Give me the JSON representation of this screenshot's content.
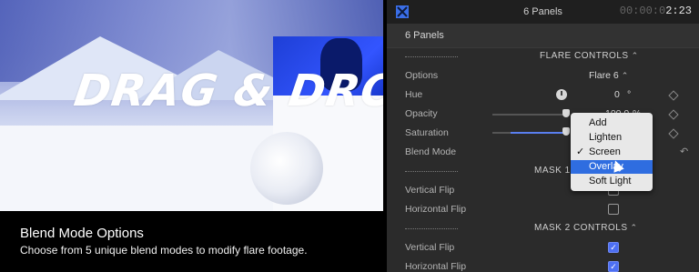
{
  "preview": {
    "overlay_text": "DRAG & DROP",
    "caption_title": "Blend Mode Options",
    "caption_subtitle": "Choose from 5 unique blend modes to modify flare footage."
  },
  "inspector": {
    "title": "6 Panels",
    "timecode_dim": "00:00:0",
    "timecode_bright": "2:23",
    "subheader": "6 Panels",
    "flare_controls": "FLARE CONTROLS",
    "options_label": "Options",
    "options_value": "Flare 6",
    "hue_label": "Hue",
    "hue_value": "0",
    "hue_unit": "°",
    "opacity_label": "Opacity",
    "opacity_value": "100.0",
    "opacity_unit": "%",
    "saturation_label": "Saturation",
    "blend_label": "Blend Mode",
    "mask1_controls": "MASK 1 C",
    "mask1_vflip_label": "Vertical Flip",
    "mask1_hflip_label": "Horizontal Flip",
    "mask2_controls": "MASK 2 CONTROLS",
    "mask2_vflip_label": "Vertical Flip",
    "mask2_hflip_label": "Horizontal Flip"
  },
  "blend_menu": {
    "items": [
      "Add",
      "Lighten",
      "Screen",
      "Overlay",
      "Soft Light"
    ],
    "selected": "Screen",
    "highlighted": "Overlay"
  },
  "colors": {
    "accent": "#2f6de0",
    "checkbox": "#4d6ff2"
  }
}
